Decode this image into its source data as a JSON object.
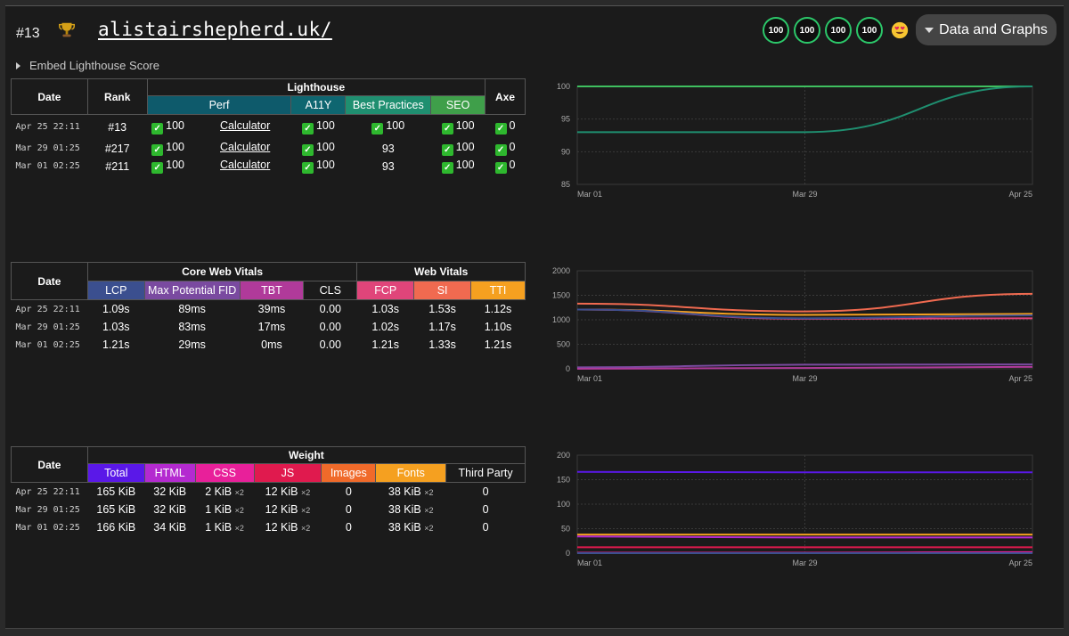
{
  "header": {
    "rank": "#13",
    "site": "alistairshepherd.uk/",
    "scores": [
      "100",
      "100",
      "100",
      "100"
    ],
    "data_button": "Data and Graphs",
    "embed_label": "Embed Lighthouse Score"
  },
  "lighthouse_table": {
    "col_date": "Date",
    "col_rank": "Rank",
    "group_lighthouse": "Lighthouse",
    "col_axe": "Axe",
    "sub": [
      "Perf",
      "A11Y",
      "Best Practices",
      "SEO"
    ],
    "sub_colors": [
      "#0e5a6b",
      "#0e6670",
      "#1f8f70",
      "#3f9f4a"
    ],
    "rows": [
      {
        "date": "Apr 25 22:11",
        "rank": "#13",
        "perf": "100",
        "calc": "Calculator",
        "a11y": "100",
        "bp": "100",
        "bp_check": true,
        "seo": "100",
        "axe": "0"
      },
      {
        "date": "Mar 29 01:25",
        "rank": "#217",
        "perf": "100",
        "calc": "Calculator",
        "a11y": "100",
        "bp": "93",
        "bp_check": false,
        "seo": "100",
        "axe": "0"
      },
      {
        "date": "Mar 01 02:25",
        "rank": "#211",
        "perf": "100",
        "calc": "Calculator",
        "a11y": "100",
        "bp": "93",
        "bp_check": false,
        "seo": "100",
        "axe": "0"
      }
    ]
  },
  "vitals_table": {
    "col_date": "Date",
    "group_core": "Core Web Vitals",
    "group_web": "Web Vitals",
    "sub": [
      "LCP",
      "Max Potential FID",
      "TBT",
      "CLS",
      "FCP",
      "SI",
      "TTI"
    ],
    "sub_colors": [
      "#3b4f8f",
      "#7a4aa0",
      "#b03a9a",
      "#1b1b1b",
      "#e0457a",
      "#f06a50",
      "#f5a020"
    ],
    "rows": [
      {
        "date": "Apr 25 22:11",
        "lcp": "1.09s",
        "fid": "89ms",
        "tbt": "39ms",
        "cls": "0.00",
        "fcp": "1.03s",
        "si": "1.53s",
        "tti": "1.12s"
      },
      {
        "date": "Mar 29 01:25",
        "lcp": "1.03s",
        "fid": "83ms",
        "tbt": "17ms",
        "cls": "0.00",
        "fcp": "1.02s",
        "si": "1.17s",
        "tti": "1.10s"
      },
      {
        "date": "Mar 01 02:25",
        "lcp": "1.21s",
        "fid": "29ms",
        "tbt": "0ms",
        "cls": "0.00",
        "fcp": "1.21s",
        "si": "1.33s",
        "tti": "1.21s"
      }
    ]
  },
  "weight_table": {
    "col_date": "Date",
    "group_weight": "Weight",
    "sub": [
      "Total",
      "HTML",
      "CSS",
      "JS",
      "Images",
      "Fonts",
      "Third Party"
    ],
    "sub_colors": [
      "#5a18e8",
      "#b42ad0",
      "#e8209a",
      "#e01a4e",
      "#f06a2a",
      "#f5a020",
      "#1b1b1b"
    ],
    "rows": [
      {
        "date": "Apr 25 22:11",
        "total": "165 KiB",
        "html": "32 KiB",
        "css": "2 KiB",
        "css_x": "×2",
        "js": "12 KiB",
        "js_x": "×2",
        "images": "0",
        "fonts": "38 KiB",
        "fonts_x": "×2",
        "third": "0"
      },
      {
        "date": "Mar 29 01:25",
        "total": "165 KiB",
        "html": "32 KiB",
        "css": "1 KiB",
        "css_x": "×2",
        "js": "12 KiB",
        "js_x": "×2",
        "images": "0",
        "fonts": "38 KiB",
        "fonts_x": "×2",
        "third": "0"
      },
      {
        "date": "Mar 01 02:25",
        "total": "166 KiB",
        "html": "34 KiB",
        "css": "1 KiB",
        "css_x": "×2",
        "js": "12 KiB",
        "js_x": "×2",
        "images": "0",
        "fonts": "38 KiB",
        "fonts_x": "×2",
        "third": "0"
      }
    ]
  },
  "chart_data": [
    {
      "type": "line",
      "x": [
        "Mar 01",
        "Mar 29",
        "Apr 25"
      ],
      "yticks": [
        85,
        90,
        95,
        100
      ],
      "ylim": [
        85,
        100
      ],
      "series": [
        {
          "color": "#3fbf5f",
          "values": [
            100,
            100,
            100
          ]
        },
        {
          "color": "#1f8f70",
          "values": [
            93,
            93,
            100
          ]
        }
      ]
    },
    {
      "type": "line",
      "x": [
        "Mar 01",
        "Mar 29",
        "Apr 25"
      ],
      "yticks": [
        0,
        500,
        1000,
        1500,
        2000
      ],
      "ylim": [
        0,
        2000
      ],
      "series": [
        {
          "color": "#f06a50",
          "values": [
            1330,
            1170,
            1530
          ]
        },
        {
          "color": "#f5a020",
          "values": [
            1210,
            1100,
            1120
          ]
        },
        {
          "color": "#e0457a",
          "values": [
            1210,
            1020,
            1030
          ]
        },
        {
          "color": "#3b4f8f",
          "values": [
            1210,
            1030,
            1090
          ]
        },
        {
          "color": "#7a4aa0",
          "values": [
            29,
            83,
            89
          ]
        },
        {
          "color": "#b03a9a",
          "values": [
            0,
            17,
            39
          ]
        }
      ]
    },
    {
      "type": "line",
      "x": [
        "Mar 01",
        "Mar 29",
        "Apr 25"
      ],
      "yticks": [
        0,
        50,
        100,
        150,
        200
      ],
      "ylim": [
        0,
        200
      ],
      "series": [
        {
          "color": "#5a18e8",
          "values": [
            166,
            165,
            165
          ]
        },
        {
          "color": "#f5a020",
          "values": [
            38,
            38,
            38
          ]
        },
        {
          "color": "#b42ad0",
          "values": [
            34,
            32,
            32
          ]
        },
        {
          "color": "#e01a4e",
          "values": [
            12,
            12,
            12
          ]
        },
        {
          "color": "#e8209a",
          "values": [
            1,
            1,
            2
          ]
        },
        {
          "color": "#3b4f8f",
          "values": [
            0,
            0,
            0
          ]
        }
      ]
    }
  ]
}
